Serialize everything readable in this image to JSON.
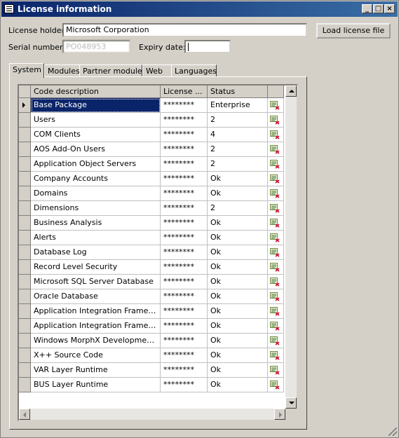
{
  "window": {
    "title": "License information"
  },
  "header": {
    "license_holder_label": "License holder:",
    "license_holder_value": "Microsoft Corporation",
    "serial_number_label": "Serial number:",
    "serial_number_value": "PO048953",
    "expiry_date_label": "Expiry date:",
    "expiry_date_value": "",
    "load_license_button": "Load license file"
  },
  "tabs": [
    {
      "label": "System",
      "active": true
    },
    {
      "label": "Modules"
    },
    {
      "label": "Partner modules"
    },
    {
      "label": "Web"
    },
    {
      "label": "Languages"
    }
  ],
  "grid": {
    "columns": [
      "Code description",
      "License ...",
      "Status"
    ],
    "rows": [
      {
        "code": "Base Package",
        "license": "********",
        "status": "Enterprise"
      },
      {
        "code": "Users",
        "license": "********",
        "status": "2"
      },
      {
        "code": "COM Clients",
        "license": "********",
        "status": "4"
      },
      {
        "code": "AOS Add-On Users",
        "license": "********",
        "status": "2"
      },
      {
        "code": "Application Object Servers",
        "license": "********",
        "status": "2"
      },
      {
        "code": "Company Accounts",
        "license": "********",
        "status": "Ok"
      },
      {
        "code": "Domains",
        "license": "********",
        "status": "Ok"
      },
      {
        "code": "Dimensions",
        "license": "********",
        "status": "2"
      },
      {
        "code": "Business Analysis",
        "license": "********",
        "status": "Ok"
      },
      {
        "code": "Alerts",
        "license": "********",
        "status": "Ok"
      },
      {
        "code": "Database Log",
        "license": "********",
        "status": "Ok"
      },
      {
        "code": "Record Level Security",
        "license": "********",
        "status": "Ok"
      },
      {
        "code": "Microsoft SQL Server Database",
        "license": "********",
        "status": "Ok"
      },
      {
        "code": "Oracle Database",
        "license": "********",
        "status": "Ok"
      },
      {
        "code": "Application Integration Framework",
        "license": "********",
        "status": "Ok"
      },
      {
        "code": "Application Integration Framework for Web Services",
        "license": "********",
        "status": "Ok"
      },
      {
        "code": "Windows MorphX Development Suite",
        "license": "********",
        "status": "Ok"
      },
      {
        "code": "X++ Source Code",
        "license": "********",
        "status": "Ok"
      },
      {
        "code": "VAR Layer Runtime",
        "license": "********",
        "status": "Ok"
      },
      {
        "code": "BUS Layer Runtime",
        "license": "********",
        "status": "Ok"
      }
    ],
    "selected_row": 0
  },
  "colors": {
    "titlebar": "#0a246a",
    "selection": "#0a246a",
    "face": "#d4d0c8"
  }
}
